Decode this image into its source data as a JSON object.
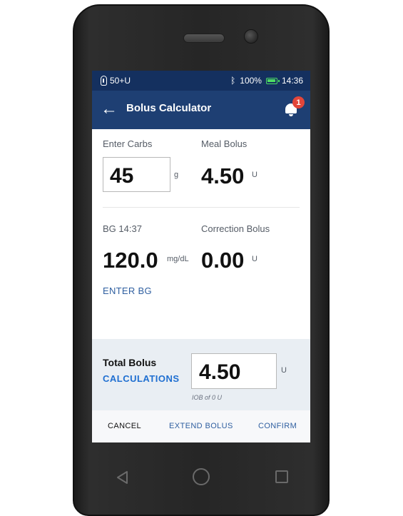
{
  "status_bar": {
    "reservoir": "50+U",
    "battery_percent": "100%",
    "time": "14:36",
    "accent": "#14305f"
  },
  "app_bar": {
    "title": "Bolus Calculator",
    "notification_count": "1",
    "background": "#1e3f73"
  },
  "carbs": {
    "label": "Enter Carbs",
    "value": "45",
    "unit": "g"
  },
  "meal_bolus": {
    "label": "Meal Bolus",
    "value": "4.50",
    "unit": "U"
  },
  "bg": {
    "label": "BG 14:37",
    "value": "120.0",
    "unit": "mg/dL",
    "enter_link": "ENTER BG"
  },
  "correction_bolus": {
    "label": "Correction Bolus",
    "value": "0.00",
    "unit": "U"
  },
  "total": {
    "title": "Total Bolus",
    "calculations_link": "CALCULATIONS",
    "value": "4.50",
    "unit": "U",
    "iob_note": "IOB of 0 U"
  },
  "actions": {
    "cancel": "CANCEL",
    "extend": "EXTEND BOLUS",
    "confirm": "CONFIRM"
  },
  "icons": [
    "pod-icon",
    "bluetooth-icon",
    "battery-icon",
    "back-arrow-icon",
    "bell-icon",
    "nav-back-icon",
    "nav-home-icon",
    "nav-recent-icon"
  ]
}
